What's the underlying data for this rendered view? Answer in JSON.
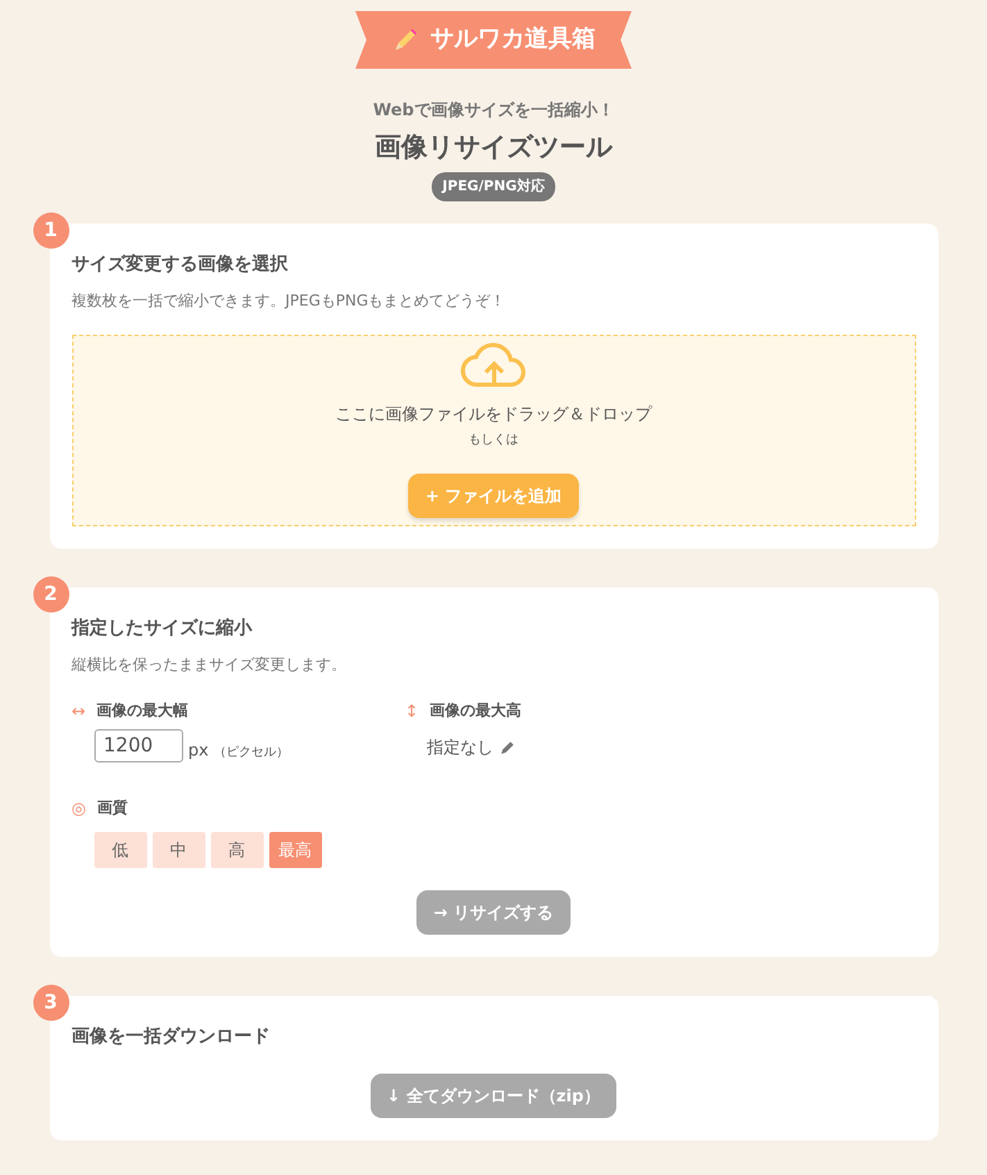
{
  "logo": {
    "text": "サルワカ道具箱"
  },
  "header": {
    "tagline": "Webで画像サイズを一括縮小！",
    "title": "画像リサイズツール",
    "badge": "JPEG/PNG対応"
  },
  "steps": [
    {
      "number": "1",
      "title": "サイズ変更する画像を選択",
      "description": "複数枚を一括で縮小できます。JPEGもPNGもまとめてどうぞ！",
      "kind": "upload",
      "dropzone": {
        "text": "ここに画像ファイルをドラッグ＆ドロップ",
        "or": "もしくは",
        "button": "+ ファイルを追加"
      }
    },
    {
      "number": "2",
      "title": "指定したサイズに縮小",
      "description": "縦横比を保ったままサイズ変更します。",
      "kind": "settings",
      "width": {
        "icon": "↔",
        "label": "画像の最大幅",
        "value": "1200",
        "unit": "px",
        "unit_note": "（ピクセル）"
      },
      "height": {
        "icon": "↕",
        "label": "画像の最大高",
        "value": "指定なし"
      },
      "quality": {
        "icon": "◎",
        "label": "画質",
        "options": [
          {
            "label": "低",
            "selected": false
          },
          {
            "label": "中",
            "selected": false
          },
          {
            "label": "高",
            "selected": false
          },
          {
            "label": "最高",
            "selected": true
          }
        ]
      },
      "button": {
        "label": "→ リサイズする",
        "disabled": true
      }
    },
    {
      "number": "3",
      "title": "画像を一括ダウンロード",
      "kind": "download",
      "button": {
        "label": "↓ 全てダウンロード（zip）",
        "disabled": true
      }
    }
  ]
}
